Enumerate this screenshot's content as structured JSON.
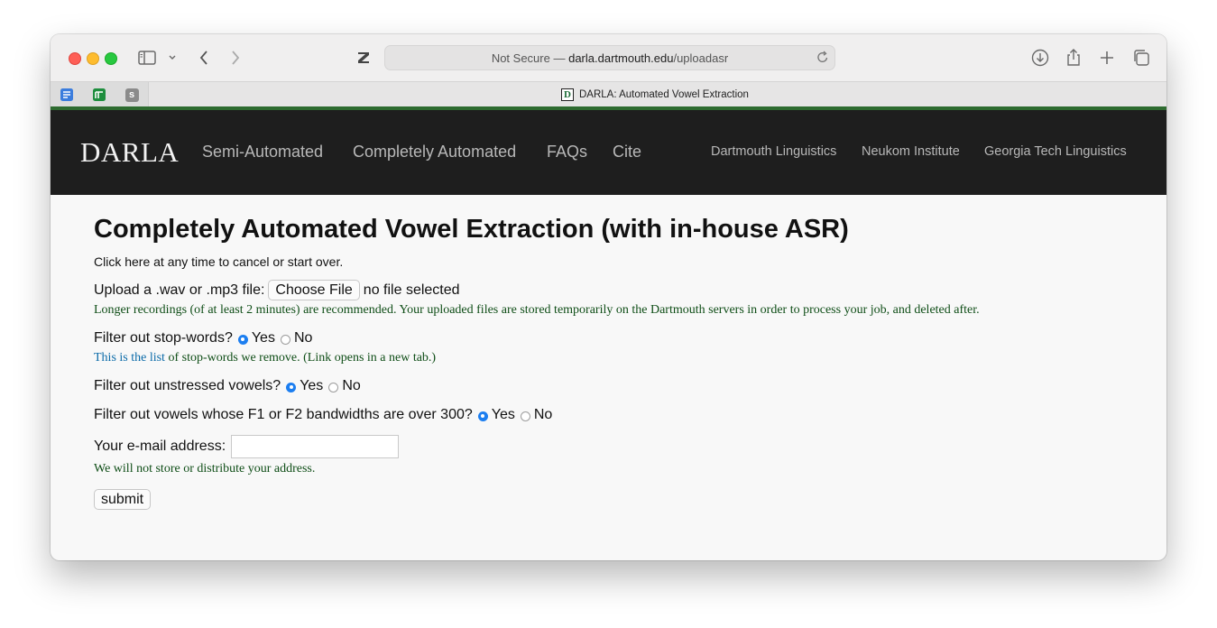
{
  "browser": {
    "address_prefix": "Not Secure — ",
    "address_host": "darla.dartmouth.edu",
    "address_path": "/uploadasr",
    "tab_title": "DARLA: Automated Vowel Extraction",
    "tab_icon_letter": "D",
    "favorite_s_label": "s"
  },
  "nav": {
    "brand": "DARLA",
    "main": [
      "Semi-Automated",
      "Completely Automated",
      "FAQs",
      "Cite"
    ],
    "side": [
      "Dartmouth Linguistics",
      "Neukom Institute",
      "Georgia Tech Linguistics"
    ]
  },
  "page": {
    "title": "Completely Automated Vowel Extraction (with in-house ASR)",
    "cancel_link": "Click here at any time to cancel or start over.",
    "upload_label": "Upload a .wav or .mp3 file:",
    "choose_file": "Choose File",
    "no_file": "no file selected",
    "upload_note": "Longer recordings (of at least 2 minutes) are recommended. Your uploaded files are stored temporarily on the Dartmouth servers in order to process your job, and deleted after.",
    "stopwords_label": "Filter out stop-words?",
    "stopwords_link": "This is the list",
    "stopwords_note": " of stop-words we remove. (Link opens in a new tab.)",
    "unstressed_label": "Filter out unstressed vowels?",
    "bandwidth_label": "Filter out vowels whose F1 or F2 bandwidths are over 300?",
    "yes": "Yes",
    "no": "No",
    "email_label": "Your e-mail address:",
    "email_value": "",
    "email_note": "We will not store or distribute your address.",
    "submit": "submit"
  }
}
